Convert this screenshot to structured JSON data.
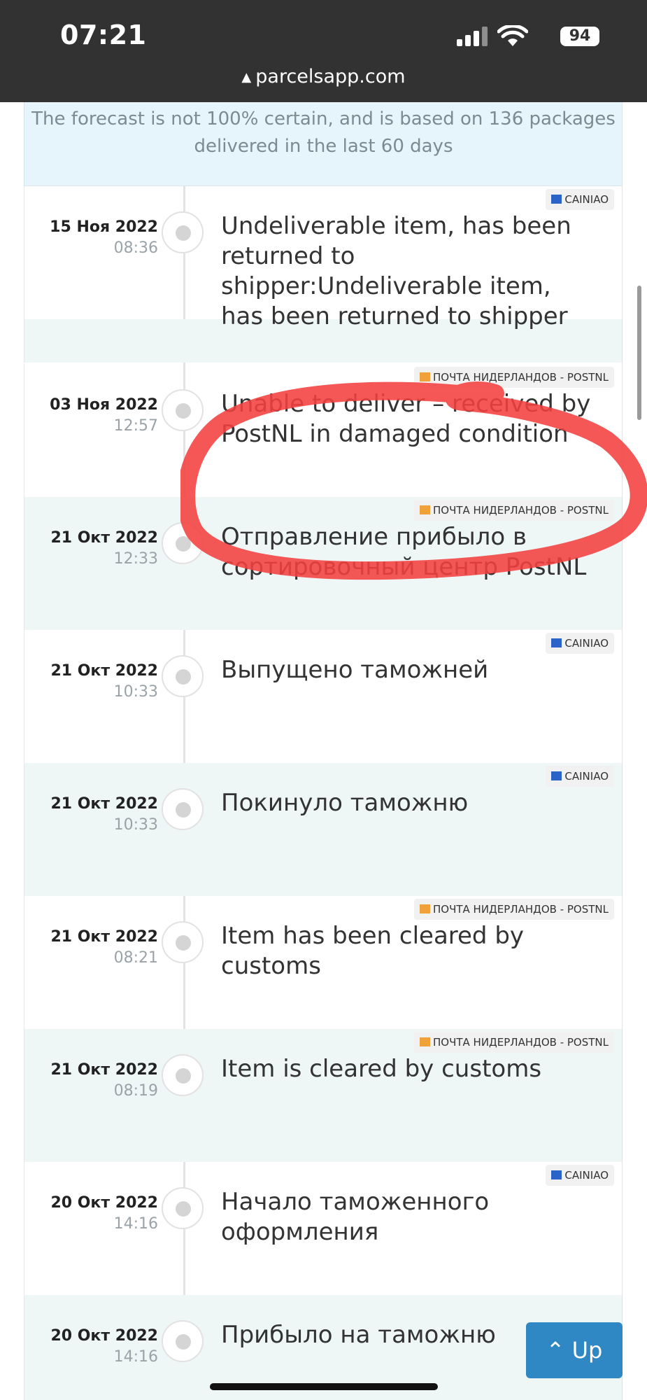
{
  "status_bar": {
    "time": "07:21",
    "battery": "94"
  },
  "url_bar": {
    "domain": "parcelsapp.com"
  },
  "forecast": {
    "text": "The forecast is not 100% certain, and is based on 136 packages delivered in the last 60 days"
  },
  "events": [
    {
      "date": "15 Ноя 2022",
      "time": "08:36",
      "description": "Undeliverable item, has been returned to shipper:Undeliverable item, has been returned to shipper",
      "source": "CAINIAO",
      "source_icon": "cainiao-icon"
    },
    {
      "date": "03 Ноя 2022",
      "time": "12:57",
      "description": "Unable to deliver – received by PostNL in damaged condition",
      "source": "ПОЧТА НИДЕРЛАНДОВ - POSTNL",
      "source_icon": "postnl-icon"
    },
    {
      "date": "21 Окт 2022",
      "time": "12:33",
      "description": "Отправление прибыло в сортировочный центр PostNL",
      "source": "ПОЧТА НИДЕРЛАНДОВ - POSTNL",
      "source_icon": "postnl-icon"
    },
    {
      "date": "21 Окт 2022",
      "time": "10:33",
      "description": "Выпущено таможней",
      "source": "CAINIAO",
      "source_icon": "cainiao-icon"
    },
    {
      "date": "21 Окт 2022",
      "time": "10:33",
      "description": "Покинуло таможню",
      "source": "CAINIAO",
      "source_icon": "cainiao-icon"
    },
    {
      "date": "21 Окт 2022",
      "time": "08:21",
      "description": "Item has been cleared by customs",
      "source": "ПОЧТА НИДЕРЛАНДОВ - POSTNL",
      "source_icon": "postnl-icon"
    },
    {
      "date": "21 Окт 2022",
      "time": "08:19",
      "description": "Item is cleared by customs",
      "source": "ПОЧТА НИДЕРЛАНДОВ - POSTNL",
      "source_icon": "postnl-icon"
    },
    {
      "date": "20 Окт 2022",
      "time": "14:16",
      "description": "Начало таможенного оформления",
      "source": "CAINIAO",
      "source_icon": "cainiao-icon"
    },
    {
      "date": "20 Окт 2022",
      "time": "14:16",
      "description": "Прибыло на таможню"
    }
  ],
  "up_button": {
    "label": "Up"
  },
  "colors": {
    "status_bar_bg": "#323232",
    "forecast_bg": "#e6f4fb",
    "alt_row_bg": "#eef6f6",
    "highlight_stroke": "#f2403f",
    "up_button_bg": "#2f87c3"
  }
}
